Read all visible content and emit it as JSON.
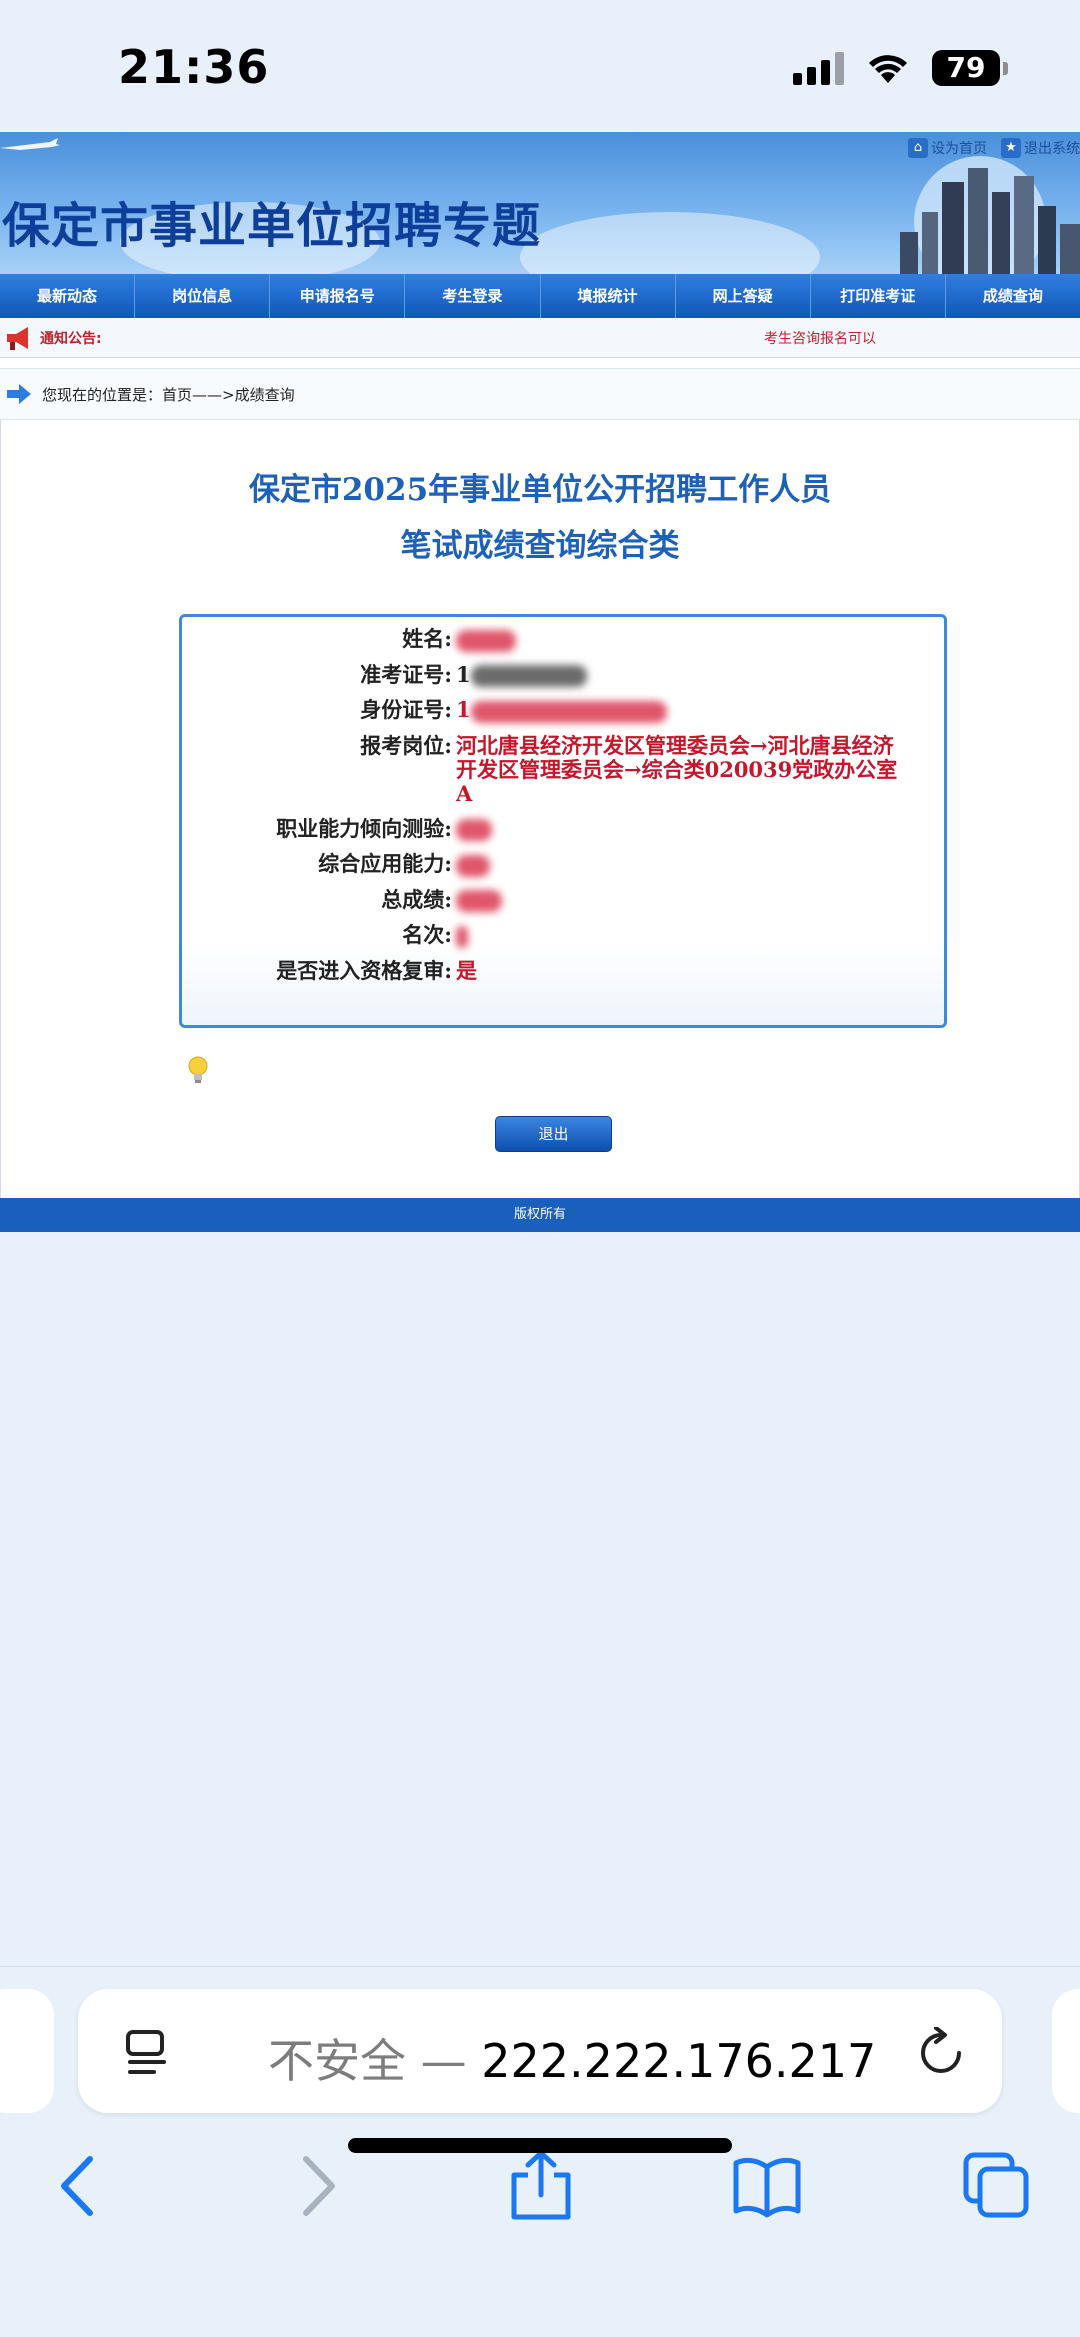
{
  "status_bar": {
    "time": "21:36",
    "battery": "79"
  },
  "header": {
    "site_title": "保定市事业单位招聘专题",
    "links": [
      {
        "label": "设为首页"
      },
      {
        "label": "退出系统"
      }
    ]
  },
  "nav": {
    "items": [
      {
        "label": "最新动态"
      },
      {
        "label": "岗位信息"
      },
      {
        "label": "申请报名号"
      },
      {
        "label": "考生登录"
      },
      {
        "label": "填报统计"
      },
      {
        "label": "网上答疑"
      },
      {
        "label": "打印准考证"
      },
      {
        "label": "成绩查询"
      }
    ]
  },
  "notice": {
    "label": "通知公告:",
    "text": "考生咨询报名可以"
  },
  "breadcrumb": {
    "text": "您现在的位置是：首页——>成绩查询"
  },
  "result": {
    "title_line1": "保定市2025年事业单位公开招聘工作人员",
    "title_line2": "笔试成绩查询综合类",
    "fields": [
      {
        "label": "姓名:",
        "value": ""
      },
      {
        "label": "准考证号:",
        "value": "1"
      },
      {
        "label": "身份证号:",
        "value": "1"
      },
      {
        "label": "报考岗位:",
        "value": "河北唐县经济开发区管理委员会→河北唐县经济开发区管理委员会→综合类020039党政办公室A"
      },
      {
        "label": "职业能力倾向测验:",
        "value": ""
      },
      {
        "label": "综合应用能力:",
        "value": ""
      },
      {
        "label": "总成绩:",
        "value": ""
      },
      {
        "label": "名次:",
        "value": ""
      },
      {
        "label": "是否进入资格复审:",
        "value": "是"
      }
    ],
    "exit_label": "退出"
  },
  "footer": {
    "text": "版权所有"
  },
  "browser": {
    "security_label": "不安全",
    "separator": " — ",
    "address": "222.222.176.217"
  },
  "colors": {
    "nav_blue": "#1057b9",
    "value_red": "#c5162b",
    "title_blue": "#1d61b8",
    "safari_bg": "#e8f0fa"
  }
}
